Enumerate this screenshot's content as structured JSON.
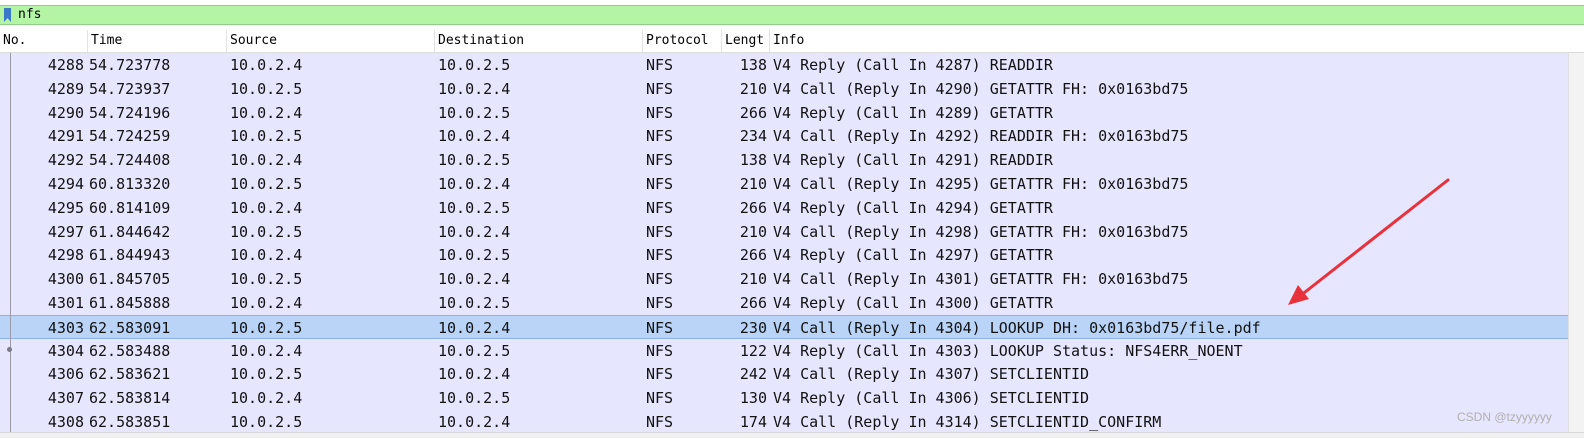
{
  "filter": {
    "value": "nfs"
  },
  "columns": [
    "No.",
    "Time",
    "Source",
    "Destination",
    "Protocol",
    "Lengt",
    "Info"
  ],
  "packets": [
    {
      "no": "4288",
      "time": "54.723778",
      "source": "10.0.2.4",
      "destination": "10.0.2.5",
      "protocol": "NFS",
      "length": "138",
      "info": "V4 Reply (Call In 4287) READDIR"
    },
    {
      "no": "4289",
      "time": "54.723937",
      "source": "10.0.2.5",
      "destination": "10.0.2.4",
      "protocol": "NFS",
      "length": "210",
      "info": "V4 Call (Reply In 4290) GETATTR FH: 0x0163bd75"
    },
    {
      "no": "4290",
      "time": "54.724196",
      "source": "10.0.2.4",
      "destination": "10.0.2.5",
      "protocol": "NFS",
      "length": "266",
      "info": "V4 Reply (Call In 4289) GETATTR"
    },
    {
      "no": "4291",
      "time": "54.724259",
      "source": "10.0.2.5",
      "destination": "10.0.2.4",
      "protocol": "NFS",
      "length": "234",
      "info": "V4 Call (Reply In 4292) READDIR FH: 0x0163bd75"
    },
    {
      "no": "4292",
      "time": "54.724408",
      "source": "10.0.2.4",
      "destination": "10.0.2.5",
      "protocol": "NFS",
      "length": "138",
      "info": "V4 Reply (Call In 4291) READDIR"
    },
    {
      "no": "4294",
      "time": "60.813320",
      "source": "10.0.2.5",
      "destination": "10.0.2.4",
      "protocol": "NFS",
      "length": "210",
      "info": "V4 Call (Reply In 4295) GETATTR FH: 0x0163bd75"
    },
    {
      "no": "4295",
      "time": "60.814109",
      "source": "10.0.2.4",
      "destination": "10.0.2.5",
      "protocol": "NFS",
      "length": "266",
      "info": "V4 Reply (Call In 4294) GETATTR"
    },
    {
      "no": "4297",
      "time": "61.844642",
      "source": "10.0.2.5",
      "destination": "10.0.2.4",
      "protocol": "NFS",
      "length": "210",
      "info": "V4 Call (Reply In 4298) GETATTR FH: 0x0163bd75"
    },
    {
      "no": "4298",
      "time": "61.844943",
      "source": "10.0.2.4",
      "destination": "10.0.2.5",
      "protocol": "NFS",
      "length": "266",
      "info": "V4 Reply (Call In 4297) GETATTR"
    },
    {
      "no": "4300",
      "time": "61.845705",
      "source": "10.0.2.5",
      "destination": "10.0.2.4",
      "protocol": "NFS",
      "length": "210",
      "info": "V4 Call (Reply In 4301) GETATTR FH: 0x0163bd75"
    },
    {
      "no": "4301",
      "time": "61.845888",
      "source": "10.0.2.4",
      "destination": "10.0.2.5",
      "protocol": "NFS",
      "length": "266",
      "info": "V4 Reply (Call In 4300) GETATTR"
    },
    {
      "no": "4303",
      "time": "62.583091",
      "source": "10.0.2.5",
      "destination": "10.0.2.4",
      "protocol": "NFS",
      "length": "230",
      "info": "V4 Call (Reply In 4304) LOOKUP DH: 0x0163bd75/file.pdf",
      "selected": true
    },
    {
      "no": "4304",
      "time": "62.583488",
      "source": "10.0.2.4",
      "destination": "10.0.2.5",
      "protocol": "NFS",
      "length": "122",
      "info": "V4 Reply (Call In 4303) LOOKUP Status: NFS4ERR_NOENT"
    },
    {
      "no": "4306",
      "time": "62.583621",
      "source": "10.0.2.5",
      "destination": "10.0.2.4",
      "protocol": "NFS",
      "length": "242",
      "info": "V4 Call (Reply In 4307) SETCLIENTID"
    },
    {
      "no": "4307",
      "time": "62.583814",
      "source": "10.0.2.4",
      "destination": "10.0.2.5",
      "protocol": "NFS",
      "length": "130",
      "info": "V4 Reply (Call In 4306) SETCLIENTID"
    },
    {
      "no": "4308",
      "time": "62.583851",
      "source": "10.0.2.5",
      "destination": "10.0.2.4",
      "protocol": "NFS",
      "length": "174",
      "info": "V4 Call (Reply In 4314) SETCLIENTID_CONFIRM"
    }
  ],
  "colors": {
    "filter_bg": "#b3f5a5",
    "row_bg": "#e7e6ff",
    "selected_bg": "#b9d4f7",
    "arrow": "#e8313a"
  },
  "watermark": "CSDN @tzyyyyyy"
}
